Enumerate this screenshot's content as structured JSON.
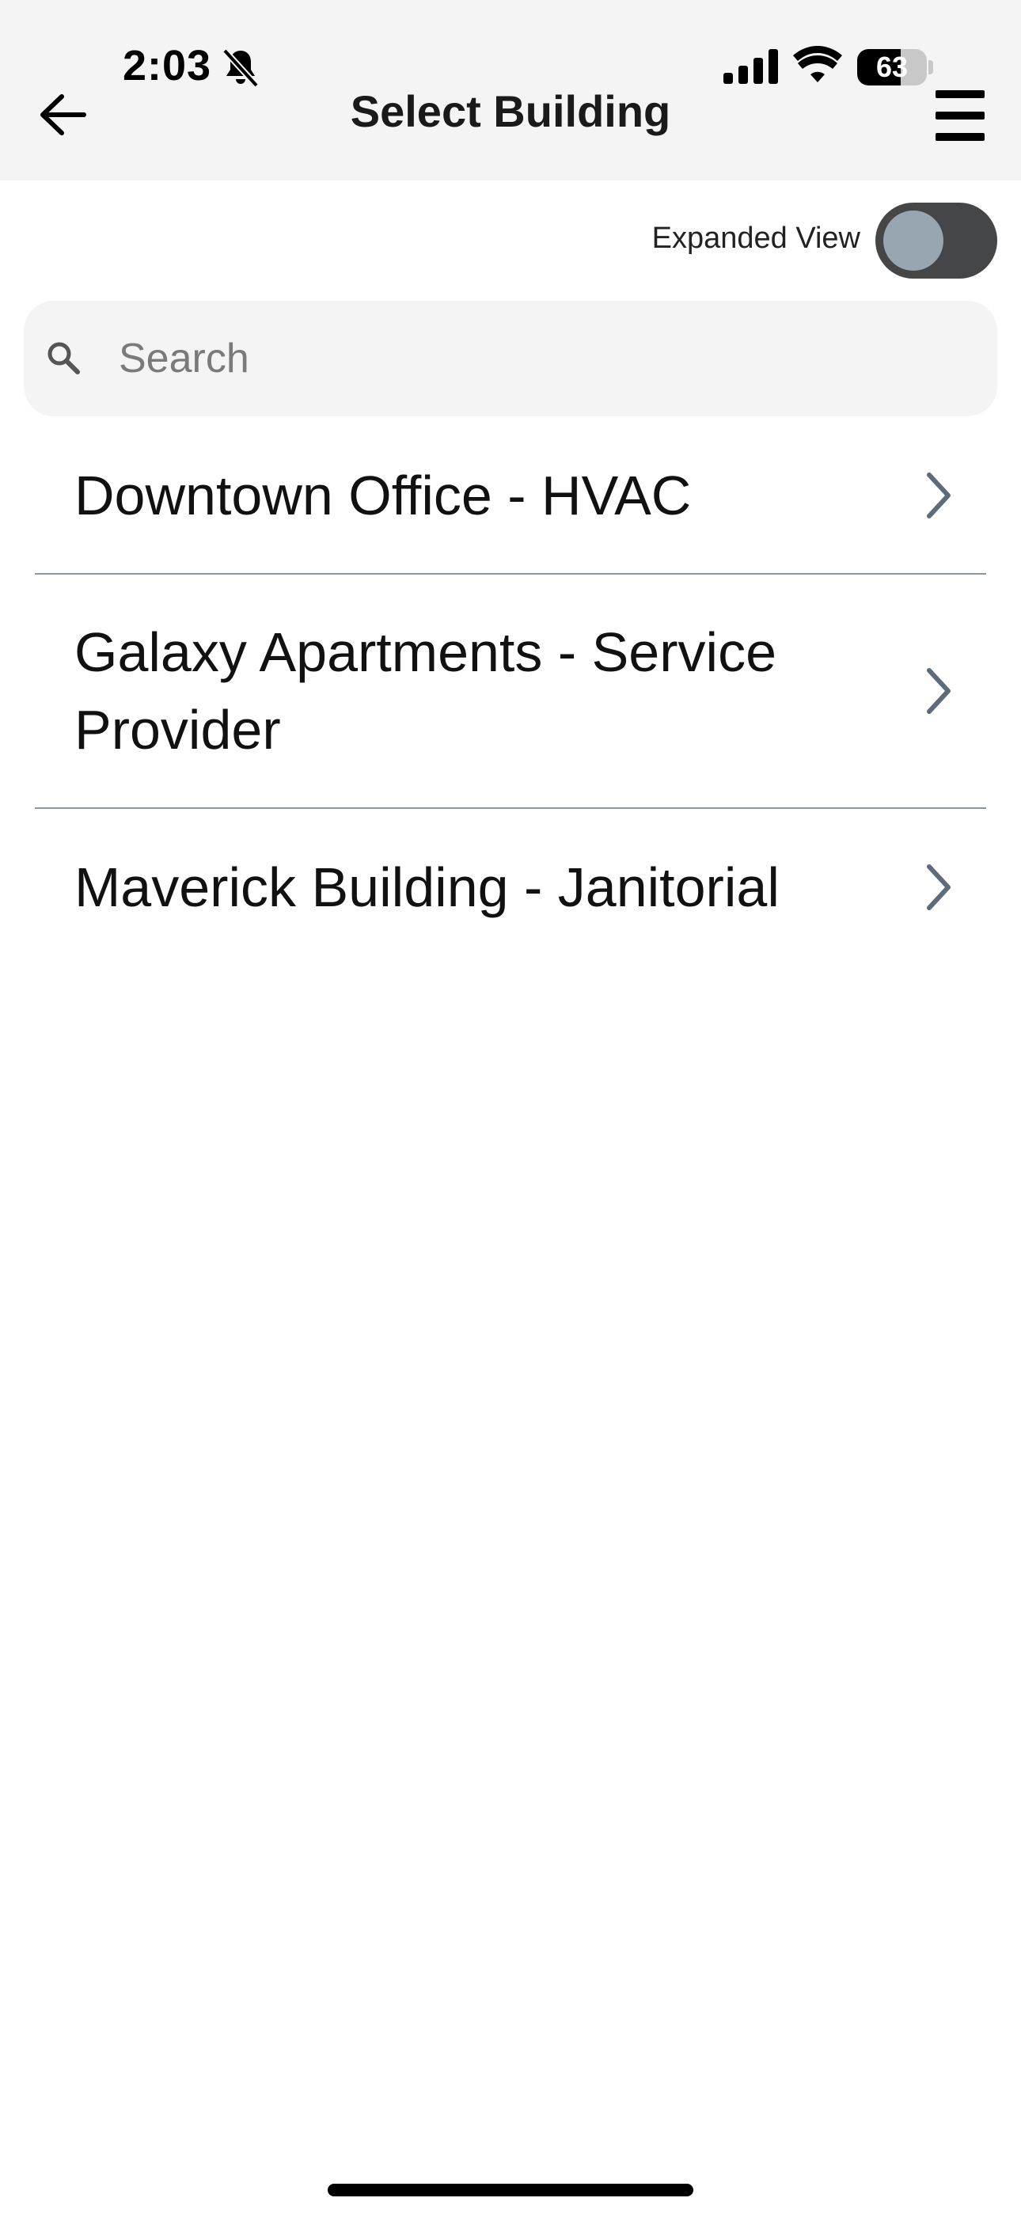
{
  "status_bar": {
    "time": "2:03",
    "battery_level": "63",
    "icons": [
      "bell-slash-icon",
      "cellular-signal-icon",
      "wifi-icon",
      "battery-icon"
    ]
  },
  "header": {
    "title": "Select Building",
    "back_icon": "arrow-left-icon",
    "menu_icon": "hamburger-menu-icon"
  },
  "expanded_view": {
    "label": "Expanded View",
    "enabled": false
  },
  "search": {
    "placeholder": "Search",
    "value": "",
    "icon": "search-icon"
  },
  "buildings": [
    {
      "label": "Downtown Office - HVAC"
    },
    {
      "label": "Galaxy Apartments - Service Provider"
    },
    {
      "label": "Maverick Building - Janitorial"
    }
  ],
  "colors": {
    "header_bg": "#f4f4f4",
    "toggle_track": "#444648",
    "toggle_knob": "#98a6b2",
    "divider": "#8c969e",
    "chevron": "#5e6b78"
  }
}
